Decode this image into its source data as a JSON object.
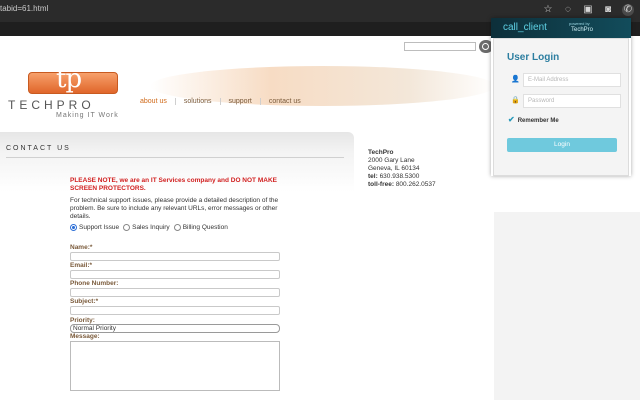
{
  "browser": {
    "url": "tabid=61.html"
  },
  "search": {
    "placeholder": ""
  },
  "logo": {
    "mark": "tp",
    "name": "TECHPRO",
    "tagline": "Making IT Work"
  },
  "nav": {
    "items": [
      "about us",
      "solutions",
      "support",
      "contact us"
    ]
  },
  "contact": {
    "title": "CONTACT US",
    "note": "PLEASE NOTE, we are an IT Services company and DO NOT MAKE SCREEN PROTECTORS.",
    "instructions": "For technical support issues, please provide a detailed description of the problem. Be sure to include any relevant URLs, error messages or other details.",
    "radios": [
      "Support Issue",
      "Sales Inquiry",
      "Billing Question"
    ],
    "name_label": "Name:*",
    "email_label": "Email:*",
    "phone_label": "Phone Number:",
    "subject_label": "Subject:*",
    "priority_label": "Priority:",
    "priority_value": "Normal Priority",
    "message_label": "Message:"
  },
  "address": {
    "company": "TechPro",
    "street": "2000 Gary Lane",
    "city": "Geneva, IL 60134",
    "tel_label": "tel:",
    "tel": "630.938.5300",
    "tollfree_label": "toll-free:",
    "tollfree": "800.262.0537"
  },
  "login": {
    "brand": "call_client",
    "powered_by": "powered by",
    "brand_company": "TechPro",
    "title": "User Login",
    "email_placeholder": "E-Mail Address",
    "password_placeholder": "Password",
    "remember": "Remember Me",
    "button": "Login"
  }
}
